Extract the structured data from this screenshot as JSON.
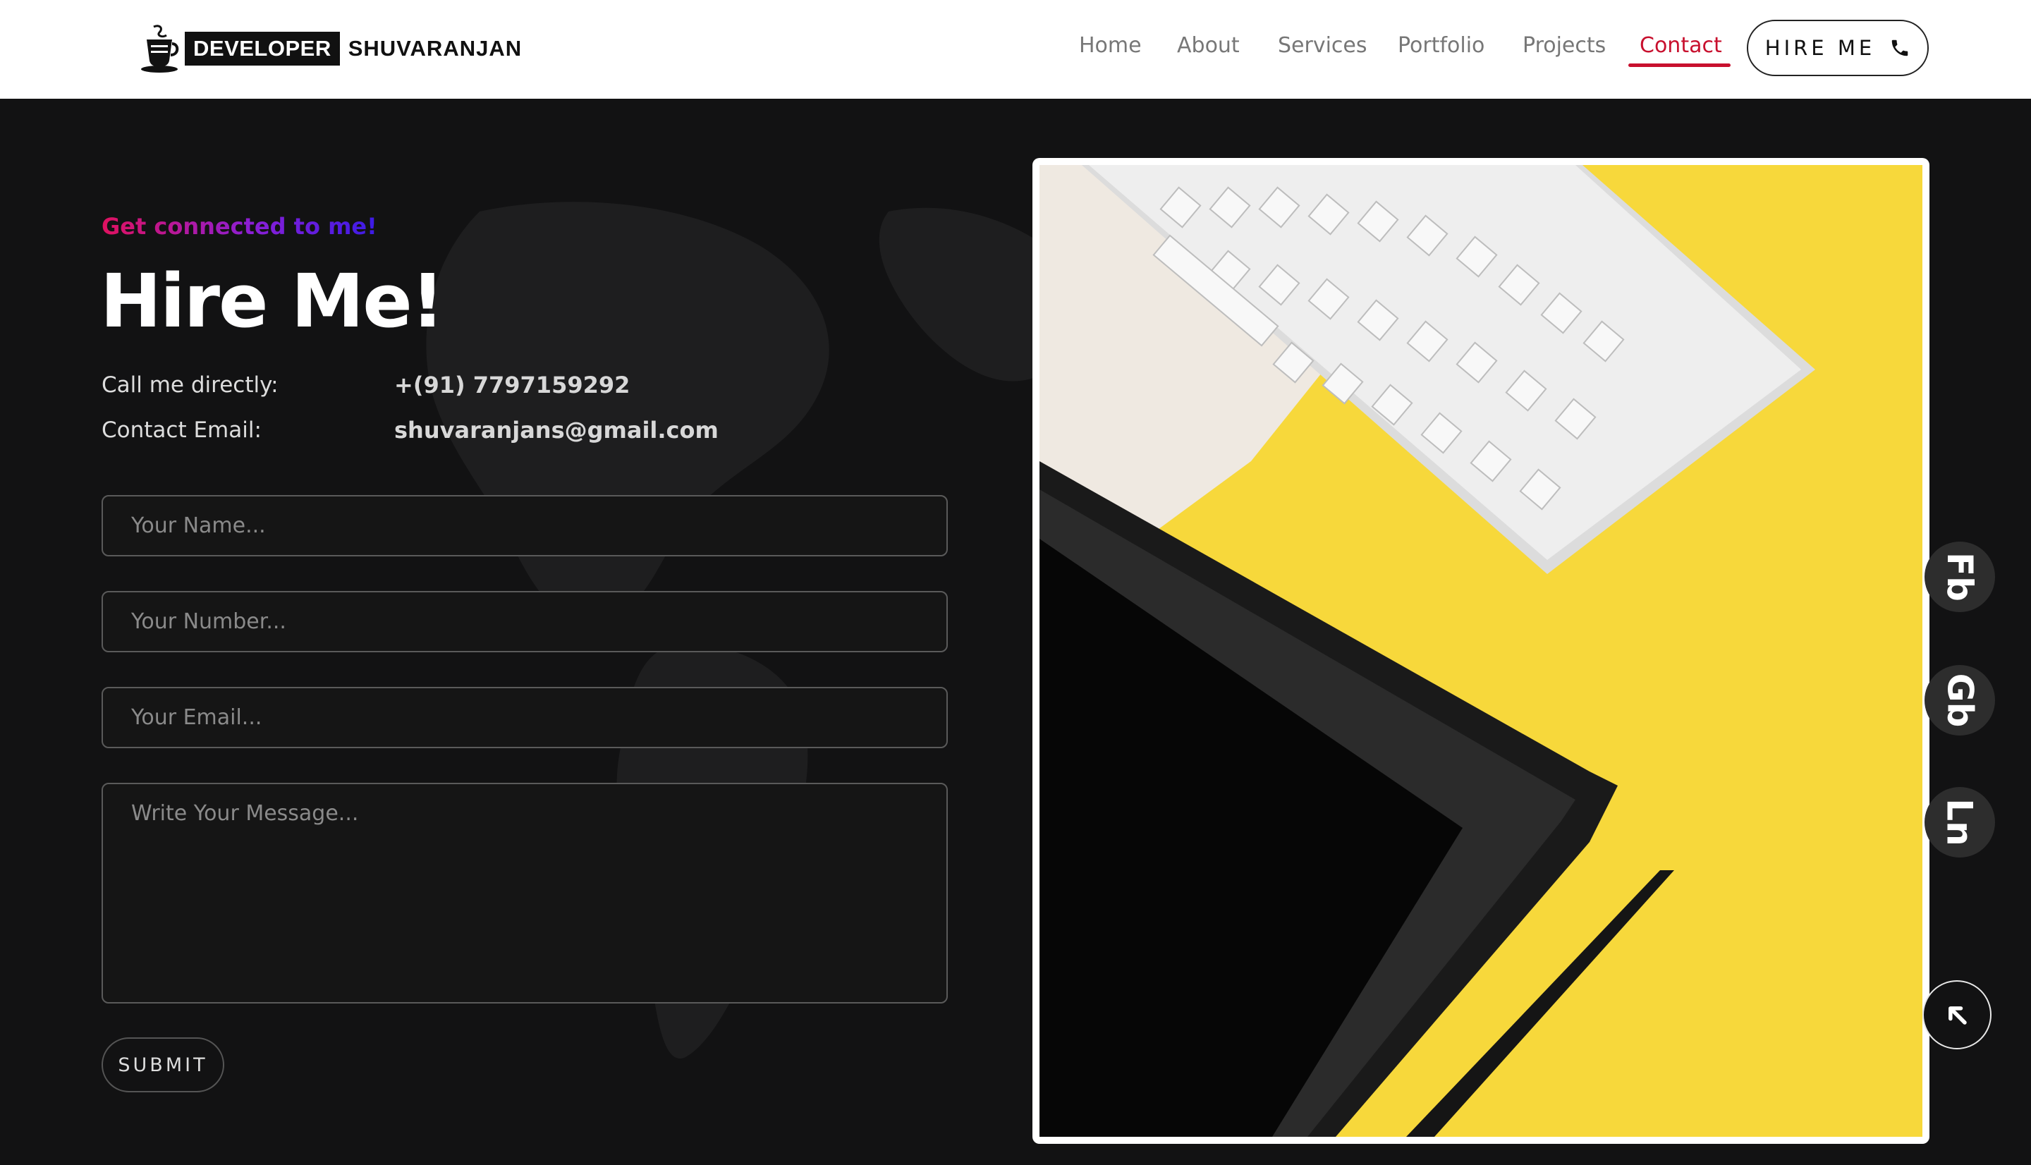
{
  "brand": {
    "box_text": "DEVELOPER",
    "name": "SHUVARANJAN"
  },
  "nav": {
    "items": [
      {
        "label": "Home"
      },
      {
        "label": "About"
      },
      {
        "label": "Services"
      },
      {
        "label": "Portfolio"
      },
      {
        "label": "Projects"
      },
      {
        "label": "Contact",
        "active": true
      }
    ],
    "hire_label": "HIRE ME",
    "hire_icon": "phone-icon"
  },
  "contact": {
    "tagline": "Get connected to me!",
    "title": "Hire Me!",
    "phone_label": "Call me directly:",
    "phone_value": "+(91) 7797159292",
    "email_label": "Contact Email:",
    "email_value": "shuvaranjans@gmail.com"
  },
  "form": {
    "name_placeholder": "Your Name...",
    "number_placeholder": "Your Number...",
    "email_placeholder": "Your Email...",
    "message_placeholder": "Write Your Message...",
    "submit_label": "SUBMIT"
  },
  "social": {
    "facebook": "Fb",
    "github": "Gb",
    "linkedin": "Ln"
  },
  "colors": {
    "accent": "#c8102e",
    "background": "#121213",
    "tagline_gradient_start": "#e0115f",
    "tagline_gradient_end": "#3b1be6",
    "image_yellow": "#f7d83b"
  }
}
